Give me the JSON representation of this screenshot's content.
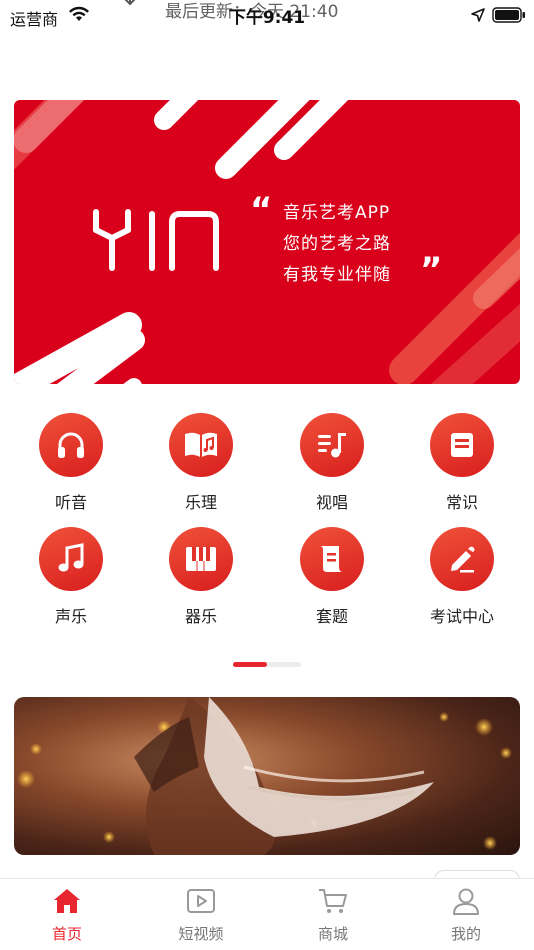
{
  "status_bar": {
    "carrier": "运营商",
    "time": "下午9:41",
    "refresh_text": "最后更新：今天 21:40"
  },
  "banner": {
    "logo": "YIN",
    "slogan_lines": [
      "音乐艺考APP",
      "您的艺考之路",
      "有我专业伴随"
    ],
    "quote_open": "“",
    "quote_close": "”",
    "colors": {
      "background": "#d9001b",
      "stripe": "#ffffff"
    }
  },
  "categories": [
    {
      "label": "听音",
      "icon": "headphones-icon"
    },
    {
      "label": "乐理",
      "icon": "music-book-icon"
    },
    {
      "label": "视唱",
      "icon": "music-list-icon"
    },
    {
      "label": "常识",
      "icon": "notes-icon"
    },
    {
      "label": "声乐",
      "icon": "music-note-icon"
    },
    {
      "label": "器乐",
      "icon": "piano-keys-icon"
    },
    {
      "label": "套题",
      "icon": "scroll-icon"
    },
    {
      "label": "考试中心",
      "icon": "pencil-icon"
    }
  ],
  "pager": {
    "pages": 2,
    "current": 1
  },
  "tabbar": {
    "items": [
      {
        "label": "首页",
        "icon": "home-icon",
        "active": true
      },
      {
        "label": "短视频",
        "icon": "video-play-icon",
        "active": false
      },
      {
        "label": "商城",
        "icon": "cart-icon",
        "active": false
      },
      {
        "label": "我的",
        "icon": "user-icon",
        "active": false
      }
    ]
  },
  "colors": {
    "accent": "#e8262f",
    "icon_gradient_start": "#f0523a",
    "icon_gradient_end": "#d81e1e"
  }
}
